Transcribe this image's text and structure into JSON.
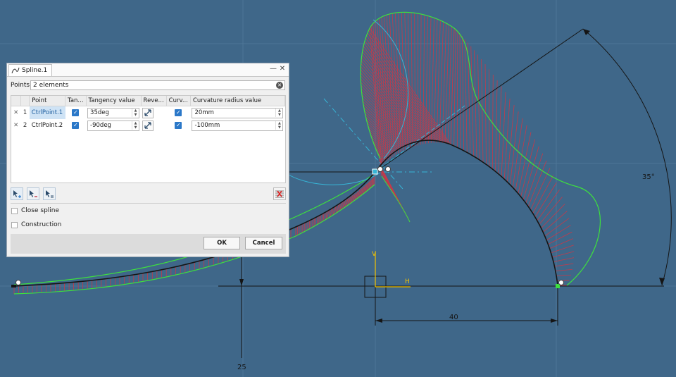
{
  "dialog": {
    "title": "Spline.1",
    "points_label": "Points",
    "points_value": "2 elements",
    "columns": {
      "point": "Point",
      "tangency": "Tan...",
      "tangency_value": "Tangency value",
      "reverse": "Reve...",
      "curvature": "Curv...",
      "curvature_radius": "Curvature radius value"
    },
    "rows": [
      {
        "index": "1",
        "point": "CtrlPoint.1",
        "tangency_value": "35deg",
        "curvature_radius": "20mm",
        "tangency_checked": true,
        "curvature_checked": true
      },
      {
        "index": "2",
        "point": "CtrlPoint.2",
        "tangency_value": "-90deg",
        "curvature_radius": "-100mm",
        "tangency_checked": true,
        "curvature_checked": true
      }
    ],
    "close_spline_label": "Close spline",
    "construction_label": "Construction",
    "ok_label": "OK",
    "cancel_label": "Cancel"
  },
  "sketch": {
    "angle_dim": "35°",
    "h_dim": "40",
    "v_dim": "25",
    "axis_h": "H",
    "axis_v": "V"
  },
  "colors": {
    "background": "#3f6789",
    "curve": "#1a1a1a",
    "comb_outline": "#3ee03e",
    "comb_spikes": "#c43a4a",
    "construction": "#37b5d6",
    "axis": "#f4c400",
    "accent": "#2b78c8"
  }
}
